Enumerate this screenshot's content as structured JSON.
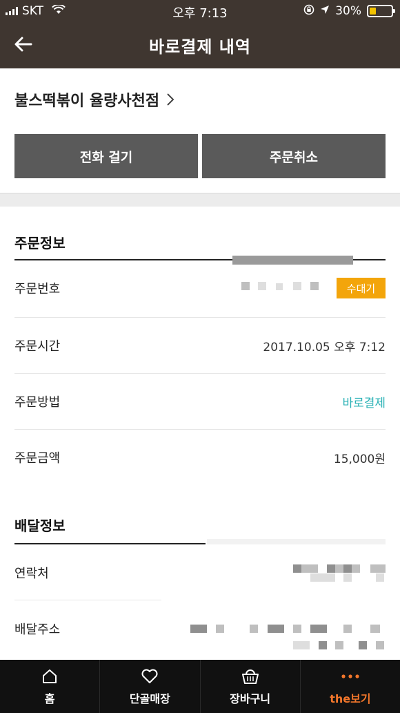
{
  "status_bar": {
    "carrier": "SKT",
    "time": "오후 7:13",
    "battery": "30%",
    "battery_level": 0.3
  },
  "nav": {
    "title": "바로결제 내역"
  },
  "store": {
    "name": "불스떡볶이 율량사천점"
  },
  "actions": {
    "call_label": "전화 걸기",
    "cancel_label": "주문취소"
  },
  "order_info": {
    "title": "주문정보",
    "rows": [
      {
        "label": "주문번호",
        "value": ""
      },
      {
        "label": "주문시간",
        "value": "2017.10.05 오후 7:12"
      },
      {
        "label": "주문방법",
        "value": "바로결제"
      },
      {
        "label": "주문금액",
        "value": "15,000원"
      }
    ],
    "status_badge": "수대기"
  },
  "delivery_info": {
    "title": "배달정보",
    "rows": [
      {
        "label": "연락처",
        "value": ""
      },
      {
        "label": "배달주소",
        "value": ""
      }
    ]
  },
  "tabbar": {
    "items": [
      {
        "label": "홈",
        "icon": "home-icon"
      },
      {
        "label": "단골매장",
        "icon": "heart-icon"
      },
      {
        "label": "장바구니",
        "icon": "basket-icon"
      },
      {
        "label": "the보기",
        "icon": "more-dots-icon"
      }
    ],
    "active_color": "#f2762b"
  },
  "colors": {
    "header_bg": "#3f3630",
    "button_bg": "#5a5a5a",
    "link_teal": "#2bb2b6",
    "badge_orange": "#f3a50b"
  }
}
